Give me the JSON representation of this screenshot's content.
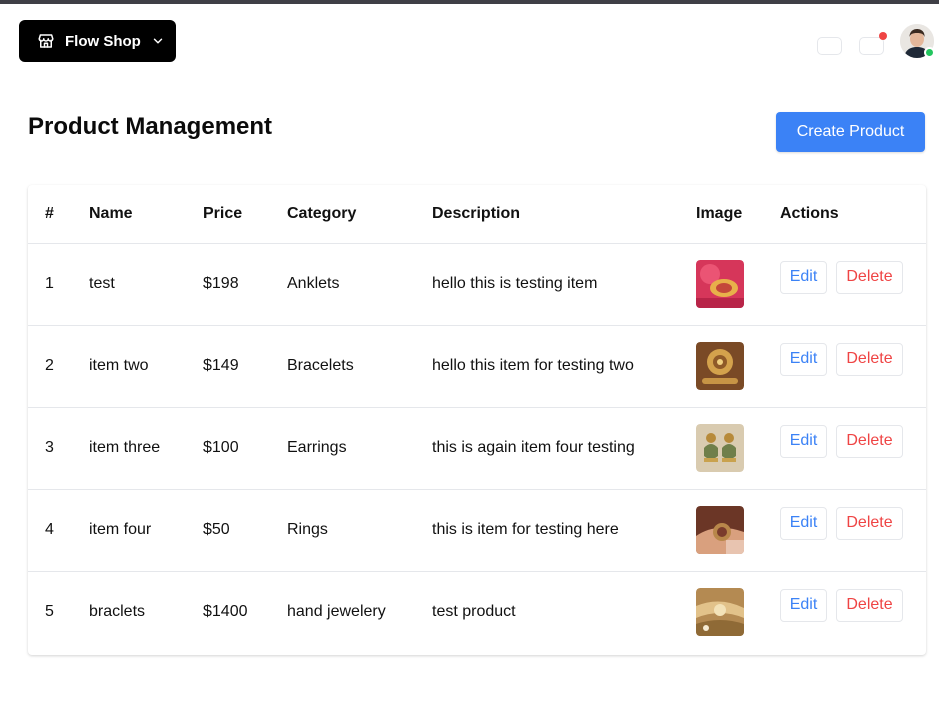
{
  "header": {
    "shop_name": "Flow Shop",
    "icons": [
      "store-icon",
      "chevron-down-icon",
      "notification-dot"
    ]
  },
  "page": {
    "title": "Product Management",
    "create_label": "Create Product"
  },
  "table": {
    "columns": [
      "#",
      "Name",
      "Price",
      "Category",
      "Description",
      "Image",
      "Actions"
    ],
    "rows": [
      {
        "num": "1",
        "name": "test",
        "price": "$198",
        "category": "Anklets",
        "description": "hello this is testing item",
        "thumb_color": "#d6365a"
      },
      {
        "num": "2",
        "name": "item two",
        "price": "$149",
        "category": "Bracelets",
        "description": "hello this item for testing two",
        "thumb_color": "#a06a3a"
      },
      {
        "num": "3",
        "name": "item three",
        "price": "$100",
        "category": "Earrings",
        "description": "this is again item four testing",
        "thumb_color": "#c8b58f"
      },
      {
        "num": "4",
        "name": "item four",
        "price": "$50",
        "category": "Rings",
        "description": "this is item for testing here",
        "thumb_color": "#8a4a32"
      },
      {
        "num": "5",
        "name": "braclets",
        "price": "$1400",
        "category": "hand jewelery",
        "description": "test product",
        "thumb_color": "#b9935a"
      }
    ],
    "edit_label": "Edit",
    "delete_label": "Delete"
  },
  "colors": {
    "primary": "#3b82f6",
    "danger": "#ef4444",
    "online": "#22c55e"
  }
}
